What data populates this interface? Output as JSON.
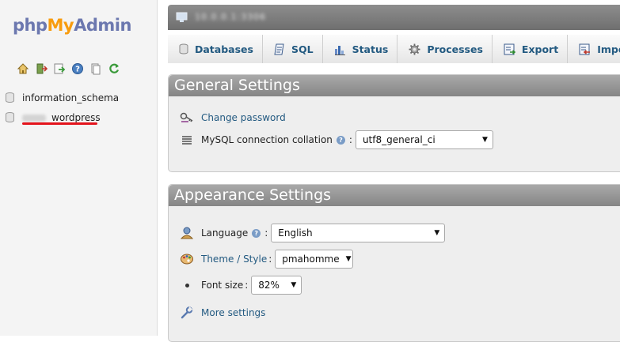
{
  "app": {
    "logo_part1": "php",
    "logo_part2": "My",
    "logo_part3": "Admin"
  },
  "nav_icons": [
    "home-icon",
    "logout-icon",
    "query-window-icon",
    "help-icon",
    "documentation-icon",
    "reload-icon"
  ],
  "databases": [
    {
      "name": "information_schema"
    },
    {
      "name": "_wordpress"
    }
  ],
  "server": {
    "name": "10.0.0.1:3306"
  },
  "tabs": [
    {
      "label": "Databases",
      "icon": "database-icon"
    },
    {
      "label": "SQL",
      "icon": "sql-icon"
    },
    {
      "label": "Status",
      "icon": "status-icon"
    },
    {
      "label": "Processes",
      "icon": "processes-icon"
    },
    {
      "label": "Export",
      "icon": "export-icon"
    },
    {
      "label": "Import",
      "icon": "import-icon"
    }
  ],
  "general": {
    "title": "General Settings",
    "change_password": "Change password",
    "collation_label": "MySQL connection collation",
    "collation_value": "utf8_general_ci"
  },
  "appearance": {
    "title": "Appearance Settings",
    "language_label": "Language",
    "language_value": "English",
    "theme_label": "Theme / Style",
    "theme_value": "pmahomme",
    "fontsize_label": "Font size",
    "fontsize_value": "82%",
    "more_settings": "More settings"
  },
  "colors": {
    "link": "#235a81",
    "logo_blue": "#6c78af",
    "logo_orange": "#f89c0e",
    "annotation_red": "#e4141c"
  }
}
